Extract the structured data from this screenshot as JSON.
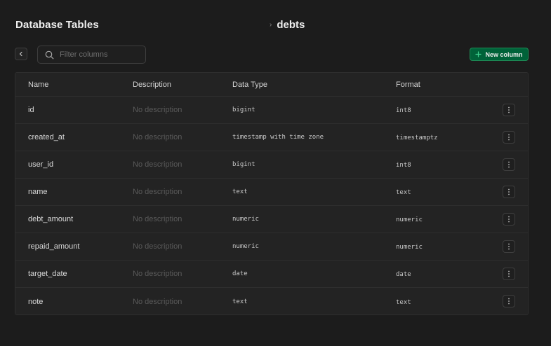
{
  "header": {
    "title": "Database Tables",
    "breadcrumb_sep": "›",
    "table_name": "debts"
  },
  "toolbar": {
    "search_placeholder": "Filter columns",
    "search_value": "",
    "new_column_label": "New column",
    "new_column_color": "#006239"
  },
  "table": {
    "headers": {
      "name": "Name",
      "description": "Description",
      "data_type": "Data Type",
      "format": "Format"
    },
    "rows": [
      {
        "name": "id",
        "description": "No description",
        "data_type": "bigint",
        "format": "int8"
      },
      {
        "name": "created_at",
        "description": "No description",
        "data_type": "timestamp with time zone",
        "format": "timestamptz"
      },
      {
        "name": "user_id",
        "description": "No description",
        "data_type": "bigint",
        "format": "int8"
      },
      {
        "name": "name",
        "description": "No description",
        "data_type": "text",
        "format": "text"
      },
      {
        "name": "debt_amount",
        "description": "No description",
        "data_type": "numeric",
        "format": "numeric"
      },
      {
        "name": "repaid_amount",
        "description": "No description",
        "data_type": "numeric",
        "format": "numeric"
      },
      {
        "name": "target_date",
        "description": "No description",
        "data_type": "date",
        "format": "date"
      },
      {
        "name": "note",
        "description": "No description",
        "data_type": "text",
        "format": "text"
      }
    ]
  },
  "icons": {
    "back": "chevron-left-icon",
    "search": "search-icon",
    "new": "plus-icon",
    "row_menu": "more-vertical-icon"
  }
}
